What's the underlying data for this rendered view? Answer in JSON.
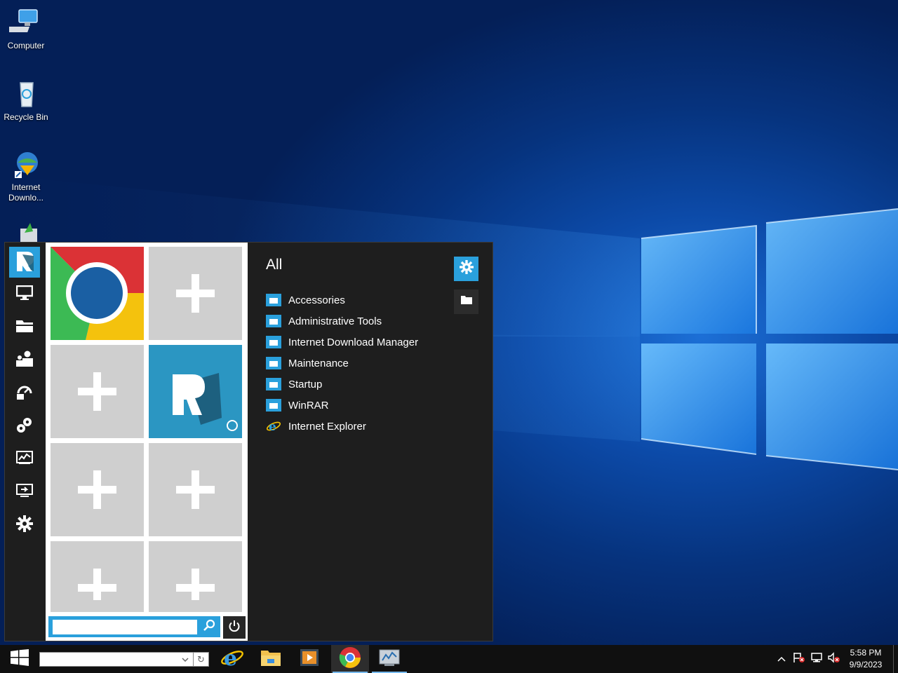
{
  "desktop": {
    "icons": [
      {
        "label": "Computer",
        "icon": "computer-icon"
      },
      {
        "label": "Recycle Bin",
        "icon": "recycle-bin-icon"
      },
      {
        "label": "Internet Downlo...",
        "icon": "internet-download-manager-icon"
      },
      {
        "label": "",
        "icon": "installer-icon"
      }
    ]
  },
  "start_menu": {
    "rail": [
      {
        "icon": "app-logo-icon",
        "active": true
      },
      {
        "icon": "monitor-icon"
      },
      {
        "icon": "folder-icon"
      },
      {
        "icon": "users-icon"
      },
      {
        "icon": "control-panel-icon"
      },
      {
        "icon": "settings-gears-icon"
      },
      {
        "icon": "performance-chart-icon"
      },
      {
        "icon": "remote-desktop-icon"
      },
      {
        "icon": "gear-icon"
      }
    ],
    "tiles": [
      {
        "type": "app",
        "icon": "chrome-icon"
      },
      {
        "type": "add"
      },
      {
        "type": "add"
      },
      {
        "type": "app",
        "icon": "app-logo-icon"
      },
      {
        "type": "add"
      },
      {
        "type": "add"
      },
      {
        "type": "add"
      },
      {
        "type": "add"
      }
    ],
    "search": {
      "value": "",
      "placeholder": ""
    },
    "programs_title": "All",
    "programs": [
      {
        "label": "Accessories",
        "icon": "folder-icon"
      },
      {
        "label": "Administrative Tools",
        "icon": "folder-icon"
      },
      {
        "label": "Internet Download Manager",
        "icon": "folder-icon"
      },
      {
        "label": "Maintenance",
        "icon": "folder-icon"
      },
      {
        "label": "Startup",
        "icon": "folder-icon"
      },
      {
        "label": "WinRAR",
        "icon": "folder-icon"
      },
      {
        "label": "Internet Explorer",
        "icon": "internet-explorer-icon"
      }
    ]
  },
  "taskbar": {
    "address_value": "",
    "pinned": [
      {
        "icon": "internet-explorer-icon"
      },
      {
        "icon": "file-explorer-icon"
      },
      {
        "icon": "media-player-icon"
      },
      {
        "icon": "chrome-icon"
      },
      {
        "icon": "server-manager-icon"
      }
    ],
    "clock_time": "5:58 PM",
    "clock_date": "9/9/2023"
  },
  "colors": {
    "accent": "#2aa0dc",
    "menu_bg": "#1e1e1e",
    "tile_bg": "#cfcfcf"
  }
}
